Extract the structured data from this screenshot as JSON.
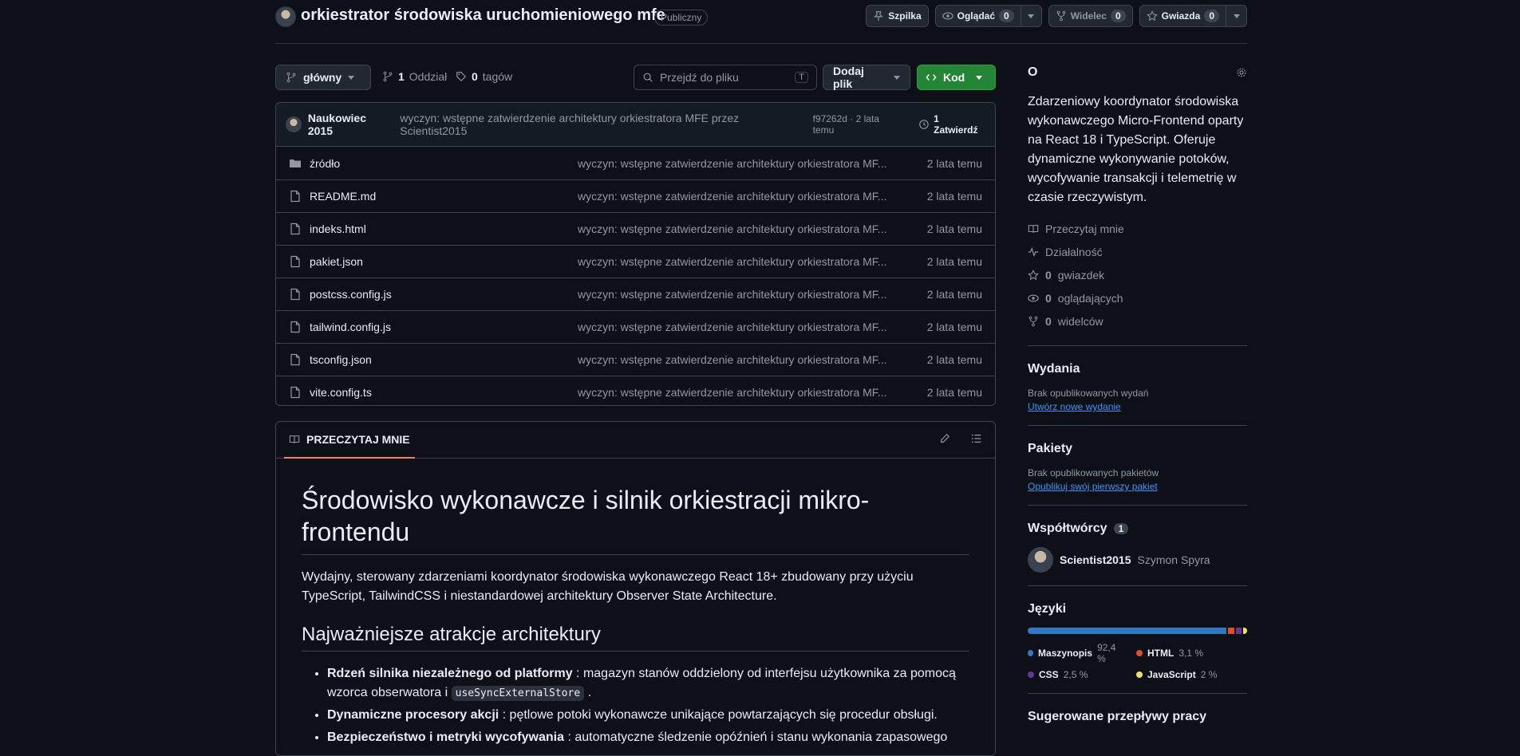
{
  "repo": {
    "title": "orkiestrator środowiska uruchomieniowego mfe",
    "visibility": "Publiczny"
  },
  "header_actions": {
    "pin": "Szpilka",
    "watch": "Oglądać",
    "watch_count": "0",
    "fork": "Widelec",
    "fork_count": "0",
    "star": "Gwiazda",
    "star_count": "0"
  },
  "toolbar": {
    "branch": "główny",
    "branches_count": "1",
    "branches_label": "Oddział",
    "tags_count": "0",
    "tags_label": "tagów",
    "goto_placeholder": "Przejdź do pliku",
    "goto_key": "T",
    "add_file": "Dodaj plik",
    "code": "Kod"
  },
  "latest_commit": {
    "author": "Naukowiec 2015",
    "message": "wyczyn: wstępne zatwierdzenie architektury orkiestratora MFE przez Scientist2015",
    "hash_time": "f97262d · 2 lata temu",
    "commits": "1 Zatwierdź"
  },
  "files": [
    {
      "name": "źródło",
      "type": "dir",
      "msg": "wyczyn: wstępne zatwierdzenie architektury orkiestratora MF...",
      "time": "2 lata temu"
    },
    {
      "name": "README.md",
      "type": "file",
      "msg": "wyczyn: wstępne zatwierdzenie architektury orkiestratora MF...",
      "time": "2 lata temu"
    },
    {
      "name": "indeks.html",
      "type": "file",
      "msg": "wyczyn: wstępne zatwierdzenie architektury orkiestratora MF...",
      "time": "2 lata temu"
    },
    {
      "name": "pakiet.json",
      "type": "file",
      "msg": "wyczyn: wstępne zatwierdzenie architektury orkiestratora MF...",
      "time": "2 lata temu"
    },
    {
      "name": "postcss.config.js",
      "type": "file",
      "msg": "wyczyn: wstępne zatwierdzenie architektury orkiestratora MF...",
      "time": "2 lata temu"
    },
    {
      "name": "tailwind.config.js",
      "type": "file",
      "msg": "wyczyn: wstępne zatwierdzenie architektury orkiestratora MF...",
      "time": "2 lata temu"
    },
    {
      "name": "tsconfig.json",
      "type": "file",
      "msg": "wyczyn: wstępne zatwierdzenie architektury orkiestratora MF...",
      "time": "2 lata temu"
    },
    {
      "name": "vite.config.ts",
      "type": "file",
      "msg": "wyczyn: wstępne zatwierdzenie architektury orkiestratora MF...",
      "time": "2 lata temu"
    }
  ],
  "readme": {
    "tab": "PRZECZYTAJ MNIE",
    "h1": "Środowisko wykonawcze i silnik orkiestracji mikro-frontendu",
    "intro": "Wydajny, sterowany zdarzeniami koordynator środowiska wykonawczego React 18+ zbudowany przy użyciu TypeScript, TailwindCSS i niestandardowej architektury Observer State Architecture.",
    "h2": "Najważniejsze atrakcje architektury",
    "bullets": [
      {
        "bold": "Rdzeń silnika niezależnego od platformy",
        "text": " : magazyn stanów oddzielony od interfejsu użytkownika za pomocą wzorca obserwatora i ",
        "code": "useSyncExternalStore",
        "tail": " ."
      },
      {
        "bold": "Dynamiczne procesory akcji",
        "text": " : pętlowe potoki wykonawcze unikające powtarzających się procedur obsługi."
      },
      {
        "bold": "Bezpieczeństwo i metryki wycofywania",
        "text": " : automatyczne śledzenie opóźnień i stanu wykonania zapasowego"
      }
    ]
  },
  "about": {
    "heading": "O",
    "description": "Zdarzeniowy koordynator środowiska wykonawczego Micro-Frontend oparty na React 18 i TypeScript. Oferuje dynamiczne wykonywanie potoków, wycofywanie transakcji i telemetrię w czasie rzeczywistym.",
    "readme": "Przeczytaj mnie",
    "activity": "Działalność",
    "stars_count": "0",
    "stars_label": "gwiazdek",
    "watchers_count": "0",
    "watchers_label": "oglądających",
    "forks_count": "0",
    "forks_label": "widelców"
  },
  "releases": {
    "heading": "Wydania",
    "empty": "Brak opublikowanych wydań",
    "link": "Utwórz nowe wydanie"
  },
  "packages": {
    "heading": "Pakiety",
    "empty": "Brak opublikowanych pakietów",
    "link": "Opublikuj swój pierwszy pakiet"
  },
  "contributors": {
    "heading": "Współtwórcy",
    "count": "1",
    "login": "Scientist2015",
    "name": "Szymon Spyra"
  },
  "languages": {
    "heading": "Języki",
    "items": [
      {
        "name": "Maszynopis",
        "pct": "92,4 %",
        "value": 92.4,
        "color": "#3178c6"
      },
      {
        "name": "HTML",
        "pct": "3,1 %",
        "value": 3.1,
        "color": "#e34c26"
      },
      {
        "name": "CSS",
        "pct": "2,5 %",
        "value": 2.5,
        "color": "#663399"
      },
      {
        "name": "JavaScript",
        "pct": "2 %",
        "value": 2,
        "color": "#f1e05a"
      }
    ]
  },
  "workflows": {
    "heading": "Sugerowane przepływy pracy"
  }
}
